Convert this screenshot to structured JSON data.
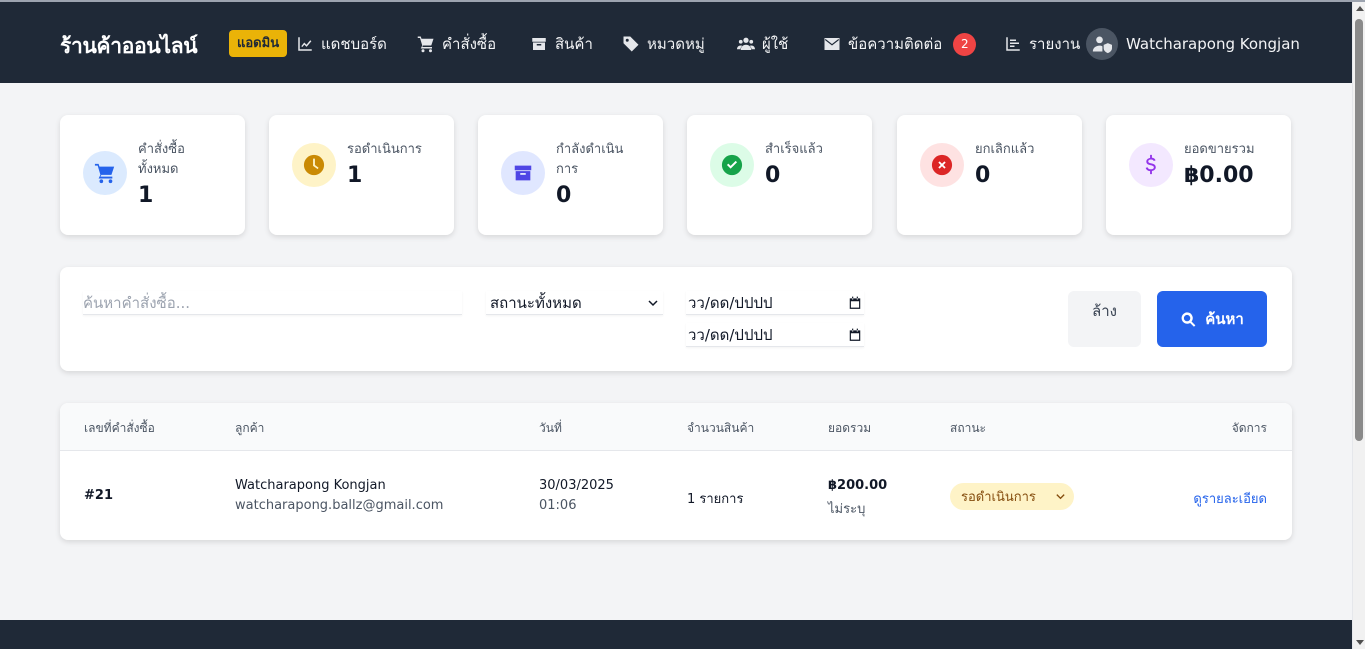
{
  "header": {
    "brand": "ร้านค้าออนไลน์",
    "admin_badge": "แอดมิน",
    "nav": [
      {
        "label": "แดชบอร์ด",
        "icon": "chart-line-icon"
      },
      {
        "label": "คำสั่งซื้อ",
        "icon": "cart-icon"
      },
      {
        "label": "สินค้า",
        "icon": "box-icon"
      },
      {
        "label": "หมวดหมู่",
        "icon": "tag-icon"
      },
      {
        "label": "ผู้ใช้",
        "icon": "users-icon"
      },
      {
        "label": "ข้อความติดต่อ",
        "icon": "envelope-icon",
        "badge": "2"
      },
      {
        "label": "รายงาน",
        "icon": "list-icon"
      }
    ],
    "user_name": "Watcharapong Kongjan"
  },
  "stats": [
    {
      "label": "คำสั่งซื้อทั้งหมด",
      "value": "1",
      "icon": "cart-icon",
      "bg": "#dbeafe",
      "color": "#2563eb"
    },
    {
      "label": "รอดำเนินการ",
      "value": "1",
      "icon": "clock-icon",
      "bg": "#fef3c7",
      "color": "#ca8a04"
    },
    {
      "label": "กำลังดำเนินการ",
      "value": "0",
      "icon": "box-icon",
      "bg": "#e0e7ff",
      "color": "#4f46e5"
    },
    {
      "label": "สำเร็จแล้ว",
      "value": "0",
      "icon": "check-circle-icon",
      "bg": "#dcfce7",
      "color": "#16a34a"
    },
    {
      "label": "ยกเลิกแล้ว",
      "value": "0",
      "icon": "x-circle-icon",
      "bg": "#fee2e2",
      "color": "#dc2626"
    },
    {
      "label": "ยอดขายรวม",
      "value": "฿0.00",
      "icon": "dollar-icon",
      "bg": "#f3e8ff",
      "color": "#9333ea"
    }
  ],
  "filters": {
    "search_placeholder": "ค้นหาคำสั่งซื้อ...",
    "status_selected": "สถานะทั้งหมด",
    "date_from": "วว/ดด/ปปปป",
    "date_to": "วว/ดด/ปปปป",
    "clear_label": "ล้าง",
    "search_label": "ค้นหา"
  },
  "table": {
    "headers": [
      "เลขที่คำสั่งซื้อ",
      "ลูกค้า",
      "วันที่",
      "จำนวนสินค้า",
      "ยอดรวม",
      "สถานะ",
      "จัดการ"
    ],
    "rows": [
      {
        "order_no": "#21",
        "customer_name": "Watcharapong Kongjan",
        "customer_email": "watcharapong.ballz@gmail.com",
        "date": "30/03/2025",
        "time": "01:06",
        "items": "1 รายการ",
        "total": "฿200.00",
        "payment": "ไม่ระบุ",
        "status": "รอดำเนินการ",
        "action": "ดูรายละเอียด"
      }
    ]
  },
  "colors": {
    "navbar": "#1f2937",
    "primary": "#2563eb",
    "badge_yellow": "#eab308",
    "message_badge": "#ef4444"
  }
}
